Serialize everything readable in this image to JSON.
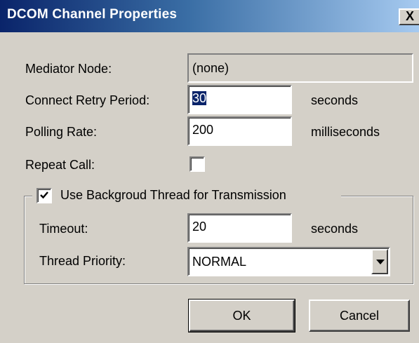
{
  "window": {
    "title": "DCOM Channel Properties",
    "close_label": "X"
  },
  "fields": {
    "mediator_node": {
      "label": "Mediator Node:",
      "value": "(none)"
    },
    "connect_retry_period": {
      "label": "Connect Retry Period:",
      "value": "30",
      "unit": "seconds"
    },
    "polling_rate": {
      "label": "Polling Rate:",
      "value": "200",
      "unit": "milliseconds"
    },
    "repeat_call": {
      "label": "Repeat Call:",
      "checked": false
    }
  },
  "background_thread": {
    "label": "Use Backgroud Thread for Transmission",
    "checked": true,
    "timeout": {
      "label": "Timeout:",
      "value": "20",
      "unit": "seconds"
    },
    "thread_priority": {
      "label": "Thread Priority:",
      "value": "NORMAL"
    }
  },
  "buttons": {
    "ok": "OK",
    "cancel": "Cancel"
  },
  "colors": {
    "dialog_bg": "#d4d0c8",
    "titlebar_start": "#0a246a",
    "titlebar_end": "#a6caf0",
    "selection": "#0a246a"
  }
}
